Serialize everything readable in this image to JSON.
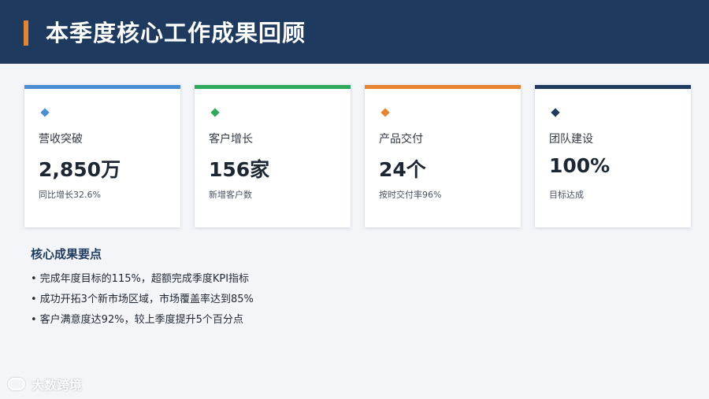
{
  "header": {
    "title": "本季度核心工作成果回顾",
    "bg_color": "#1e3a5f",
    "accent_color": "#e8842f"
  },
  "cards": [
    {
      "label": "营收突破",
      "value": "2,850万",
      "sub": "同比增长32.6%",
      "color": "#4a8fd6",
      "icon": "diamond-icon"
    },
    {
      "label": "客户增长",
      "value": "156家",
      "sub": "新增客户数",
      "color": "#2eaa5c",
      "icon": "diamond-icon"
    },
    {
      "label": "产品交付",
      "value": "24个",
      "sub": "按时交付率96%",
      "color": "#e8842f",
      "icon": "diamond-icon"
    },
    {
      "label": "团队建设",
      "value": "100%",
      "sub": "目标达成",
      "color": "#1e3a5f",
      "icon": "diamond-icon"
    }
  ],
  "key_points": {
    "heading": "核心成果要点",
    "bullet": "•",
    "items": [
      "完成年度目标的115%，超额完成季度KPI指标",
      "成功开拓3个新市场区域，市场覆盖率达到85%",
      "客户满意度达92%，较上季度提升5个百分点"
    ]
  },
  "watermark": {
    "text": "大数跨境"
  }
}
